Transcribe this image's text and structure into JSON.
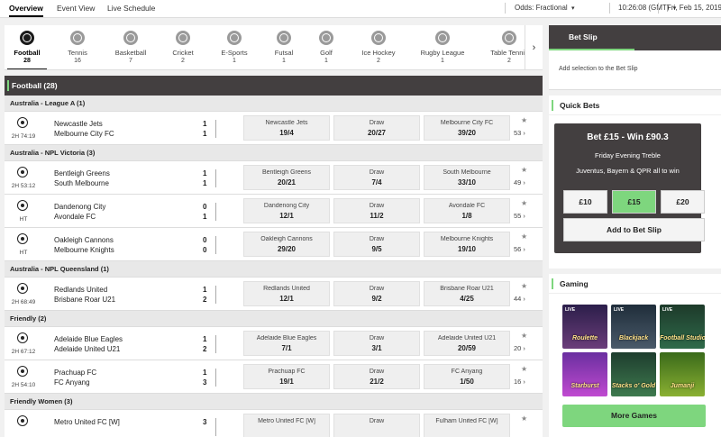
{
  "nav": {
    "tabs": [
      {
        "label": "Overview"
      },
      {
        "label": "Event View"
      },
      {
        "label": "Live Schedule"
      }
    ],
    "odds_label": "Odds:",
    "odds_value": "Fractional",
    "time": "10:26:08",
    "timezone": "(GMT)",
    "date": "Fri, Feb 15, 2019"
  },
  "sports": [
    {
      "label": "Football",
      "count": "28",
      "icon": "football-icon"
    },
    {
      "label": "Tennis",
      "count": "16",
      "icon": "tennis-icon"
    },
    {
      "label": "Basketball",
      "count": "7",
      "icon": "basketball-icon"
    },
    {
      "label": "Cricket",
      "count": "2",
      "icon": "cricket-icon"
    },
    {
      "label": "E-Sports",
      "count": "1",
      "icon": "gamepad-icon"
    },
    {
      "label": "Futsal",
      "count": "1",
      "icon": "futsal-icon"
    },
    {
      "label": "Golf",
      "count": "1",
      "icon": "golf-icon"
    },
    {
      "label": "Ice Hockey",
      "count": "2",
      "icon": "ice-hockey-icon"
    },
    {
      "label": "Rugby League",
      "count": "1",
      "icon": "rugby-icon"
    },
    {
      "label": "Table Tennis",
      "count": "2",
      "icon": "table-tennis-icon"
    }
  ],
  "section": {
    "title": "Football (28)"
  },
  "groups": [
    {
      "label": "Australia - League A (1)"
    },
    {
      "label": "Australia - NPL Victoria (3)"
    },
    {
      "label": "Australia - NPL Queensland (1)"
    },
    {
      "label": "Friendly (2)"
    },
    {
      "label": "Friendly Women (3)"
    }
  ],
  "matches": [
    {
      "time": "2H 74:19",
      "team1": "Newcastle Jets",
      "team2": "Melbourne City FC",
      "score1": "1",
      "score2": "1",
      "home_label": "Newcastle Jets",
      "home_price": "19/4",
      "draw_label": "Draw",
      "draw_price": "20/27",
      "away_label": "Melbourne City FC",
      "away_price": "39/20",
      "more": "53"
    },
    {
      "time": "2H 53:12",
      "team1": "Bentleigh Greens",
      "team2": "South Melbourne",
      "score1": "1",
      "score2": "1",
      "home_label": "Bentleigh Greens",
      "home_price": "20/21",
      "draw_label": "Draw",
      "draw_price": "7/4",
      "away_label": "South Melbourne",
      "away_price": "33/10",
      "more": "49"
    },
    {
      "time": "HT",
      "team1": "Dandenong City",
      "team2": "Avondale FC",
      "score1": "0",
      "score2": "1",
      "home_label": "Dandenong City",
      "home_price": "12/1",
      "draw_label": "Draw",
      "draw_price": "11/2",
      "away_label": "Avondale FC",
      "away_price": "1/8",
      "more": "55"
    },
    {
      "time": "HT",
      "team1": "Oakleigh Cannons",
      "team2": "Melbourne Knights",
      "score1": "0",
      "score2": "0",
      "home_label": "Oakleigh Cannons",
      "home_price": "29/20",
      "draw_label": "Draw",
      "draw_price": "9/5",
      "away_label": "Melbourne Knights",
      "away_price": "19/10",
      "more": "56"
    },
    {
      "time": "2H 68:49",
      "team1": "Redlands United",
      "team2": "Brisbane Roar U21",
      "score1": "1",
      "score2": "2",
      "home_label": "Redlands United",
      "home_price": "12/1",
      "draw_label": "Draw",
      "draw_price": "9/2",
      "away_label": "Brisbane Roar U21",
      "away_price": "4/25",
      "more": "44"
    },
    {
      "time": "2H 67:12",
      "team1": "Adelaide Blue Eagles",
      "team2": "Adelaide United U21",
      "score1": "1",
      "score2": "2",
      "home_label": "Adelaide Blue Eagles",
      "home_price": "7/1",
      "draw_label": "Draw",
      "draw_price": "3/1",
      "away_label": "Adelaide United U21",
      "away_price": "20/59",
      "more": "20"
    },
    {
      "time": "2H 54:10",
      "team1": "Prachuap FC",
      "team2": "FC Anyang",
      "score1": "1",
      "score2": "3",
      "home_label": "Prachuap FC",
      "home_price": "19/1",
      "draw_label": "Draw",
      "draw_price": "21/2",
      "away_label": "FC Anyang",
      "away_price": "1/50",
      "more": "16"
    },
    {
      "time": "",
      "team1": "Metro United FC [W]",
      "team2": "",
      "score1": "3",
      "score2": "",
      "home_label": "Metro United FC [W]",
      "home_price": "",
      "draw_label": "Draw",
      "draw_price": "",
      "away_label": "Fulham United FC [W]",
      "away_price": "",
      "more": ""
    }
  ],
  "betslip": {
    "tab_label": "Bet Slip",
    "empty_text": "Add selection to the Bet Slip"
  },
  "quickbets": {
    "title": "Quick Bets",
    "headline": "Bet £15 - Win £90.3",
    "subtitle": "Friday Evening Treble",
    "description": "Juventus, Bayern & QPR all to win",
    "stakes": [
      "£10",
      "£15",
      "£20"
    ],
    "add_button": "Add to Bet Slip"
  },
  "gaming": {
    "title": "Gaming",
    "games": [
      {
        "name": "Roulette",
        "live": "LIVE"
      },
      {
        "name": "Blackjack",
        "live": "LIVE"
      },
      {
        "name": "Football Studio",
        "live": "LIVE"
      },
      {
        "name": "Starburst",
        "live": ""
      },
      {
        "name": "Stacks o' Gold",
        "live": ""
      },
      {
        "name": "Jumanji",
        "live": ""
      }
    ],
    "more_button": "More Games"
  },
  "colors": {
    "accent_green": "#7ed67e",
    "dark_header": "#433f40"
  }
}
